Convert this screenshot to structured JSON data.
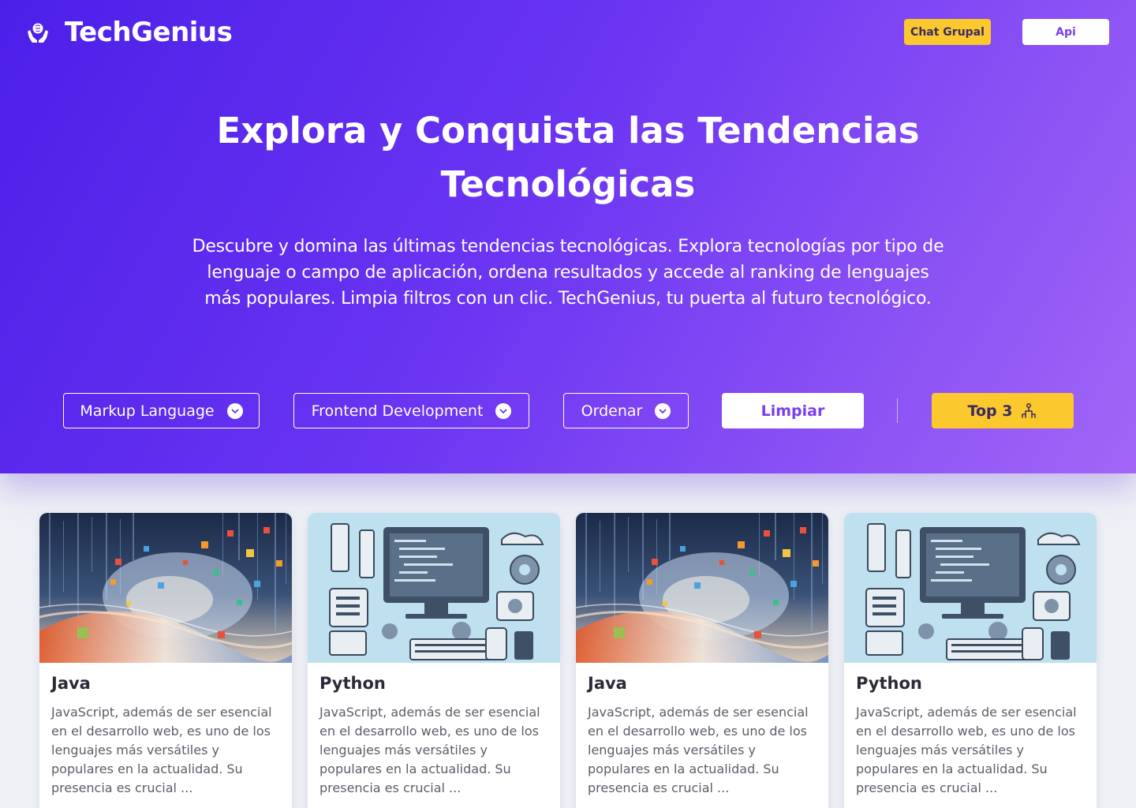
{
  "header": {
    "brand_name": "TechGenius",
    "brand_icon": "brain-hands-icon",
    "chat_button": "Chat Grupal",
    "api_button": "Api"
  },
  "hero": {
    "title": "Explora y Conquista las Tendencias Tecnológicas",
    "description": "Descubre y domina las últimas tendencias tecnológicas. Explora tecnologías por tipo de lenguaje o campo de aplicación, ordena resultados y accede al ranking de lenguajes más populares. Limpia filtros con un clic. TechGenius, tu puerta al futuro tecnológico."
  },
  "filters": {
    "language_type": "Markup Language",
    "application_field": "Frontend Development",
    "order": "Ordenar",
    "clear_button": "Limpiar",
    "top_button": "Top 3",
    "top_icon": "podium-icon"
  },
  "cards": [
    {
      "title": "Java",
      "description": "JavaScript, además de ser esencial en el desarrollo web, es uno de los lenguajes más versátiles y populares en la actualidad. Su presencia es crucial ...",
      "image": "abstract-data-stream-image"
    },
    {
      "title": "Python",
      "description": "JavaScript, además de ser esencial en el desarrollo web, es uno de los lenguajes más versátiles y populares en la actualidad. Su presencia es crucial ...",
      "image": "developer-tools-flatlay-image"
    },
    {
      "title": "Java",
      "description": "JavaScript, además de ser esencial en el desarrollo web, es uno de los lenguajes más versátiles y populares en la actualidad. Su presencia es crucial ...",
      "image": "abstract-data-stream-image"
    },
    {
      "title": "Python",
      "description": "JavaScript, además de ser esencial en el desarrollo web, es uno de los lenguajes más versátiles y populares en la actualidad. Su presencia es crucial ...",
      "image": "developer-tools-flatlay-image"
    }
  ],
  "colors": {
    "hero_gradient_start": "#4c1fe8",
    "hero_gradient_end": "#a266f6",
    "accent_yellow": "#fbc82d",
    "accent_purple": "#7b3df0",
    "page_background": "#eef0f6"
  }
}
